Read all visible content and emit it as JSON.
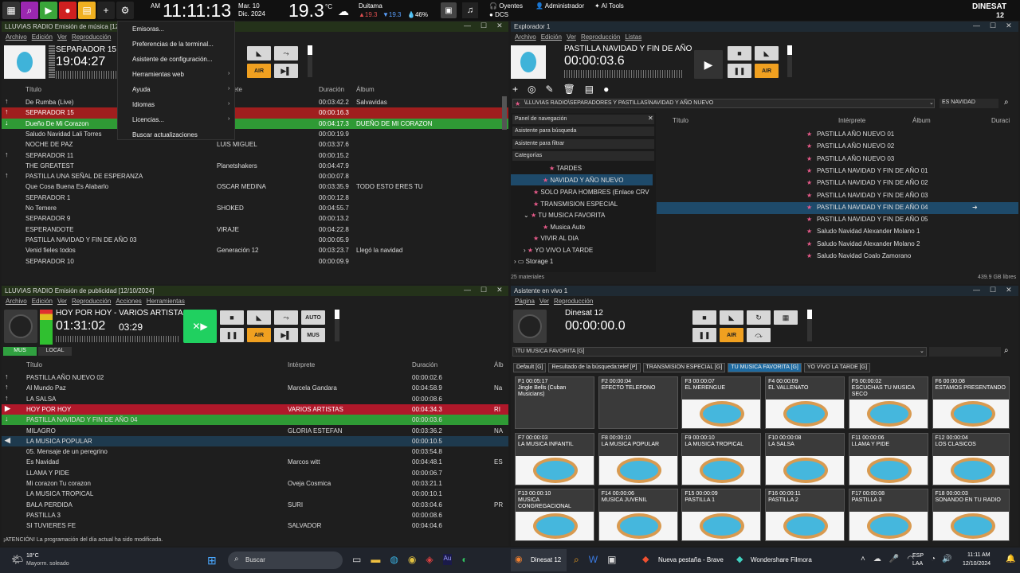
{
  "topbar": {
    "ampm": "AM",
    "time": "11:11:13",
    "date1": "Mar. 10",
    "date2": "Dic. 2024",
    "temp": "19.3",
    "tempunit": "°C",
    "city": "Duitama",
    "t_hi": "19.3",
    "t_lo": "19.3",
    "humidity": "46%",
    "oyentes": "Oyentes",
    "dcs": "DCS",
    "admin": "Administrador",
    "aitools": "AI Tools",
    "brand": "DINESAT",
    "brand_num": "12"
  },
  "music": {
    "title": "LLUVIAS RADIO Emisión de música [12/",
    "menu": [
      "Archivo",
      "Edición",
      "Ver",
      "Reproducción"
    ],
    "now": "SEPARADOR 15",
    "clock": "19:04:27",
    "air": "AIR",
    "headers": {
      "title": "Título",
      "artist": "rprete",
      "duration": "Duración",
      "album": "Álbum"
    },
    "rows": [
      {
        "t": "De Rumba (Live)",
        "a": "o Vivo",
        "d": "00:03:42.2",
        "al": "Salvavidas",
        "ic": "↑"
      },
      {
        "t": "SEPARADOR 15",
        "a": "",
        "d": "00:00:16.3",
        "al": "",
        "ic": "↑"
      },
      {
        "t": "Dueño De Mi Corazon",
        "a": "",
        "d": "00:04:17.3",
        "al": "DUEÑO DE MI CORAZON",
        "ic": "↓"
      },
      {
        "t": "Saludo Navidad Lali Torres",
        "a": "",
        "d": "00:00:19.9",
        "al": "",
        "ic": ""
      },
      {
        "t": "NOCHE DE PAZ",
        "a": "LUIS MIGUEL",
        "d": "00:03:37.6",
        "al": "",
        "ic": ""
      },
      {
        "t": "SEPARADOR 11",
        "a": "",
        "d": "00:00:15.2",
        "al": "",
        "ic": "↑"
      },
      {
        "t": "THE GREATEST",
        "a": "Planetshakers",
        "d": "00:04:47.9",
        "al": "",
        "ic": ""
      },
      {
        "t": "PASTILLA UNA SEÑAL DE ESPERANZA",
        "a": "",
        "d": "00:00:07.8",
        "al": "",
        "ic": "↑"
      },
      {
        "t": "Que Cosa Buena Es Alabarlo",
        "a": "OSCAR MEDINA",
        "d": "00:03:35.9",
        "al": "TODO ESTO ERES TU",
        "ic": ""
      },
      {
        "t": "SEPARADOR 1",
        "a": "",
        "d": "00:00:12.8",
        "al": "",
        "ic": ""
      },
      {
        "t": "No Temere",
        "a": "SHOKED",
        "d": "00:04:55.7",
        "al": "",
        "ic": ""
      },
      {
        "t": "SEPARADOR 9",
        "a": "",
        "d": "00:00:13.2",
        "al": "",
        "ic": ""
      },
      {
        "t": "ESPERANDOTE",
        "a": "VIRAJE",
        "d": "00:04:22.8",
        "al": "",
        "ic": ""
      },
      {
        "t": "PASTILLA NAVIDAD Y FIN DE AÑO 03",
        "a": "",
        "d": "00:00:05.9",
        "al": "",
        "ic": ""
      },
      {
        "t": "Venid fieles todos",
        "a": "Generación 12",
        "d": "00:03:23.7",
        "al": "Llegó la navidad",
        "ic": ""
      },
      {
        "t": "SEPARADOR 10",
        "a": "",
        "d": "00:00:09.9",
        "al": "",
        "ic": ""
      }
    ]
  },
  "dropdown": [
    "Emisoras...",
    "Preferencias de la terminal...",
    "Asistente de configuración...",
    "Herramientas web",
    "Ayuda",
    "Idiomas",
    "Licencias...",
    "Buscar actualizaciones"
  ],
  "explorer": {
    "title": "Explorador 1",
    "menu": [
      "Archivo",
      "Edición",
      "Ver",
      "Reproducción",
      "Listas"
    ],
    "now": "PASTILLA NAVIDAD Y FIN DE AÑO",
    "clock": "00:00:03.6",
    "air": "AIR",
    "path": "\\LLUVIAS RADIO\\SEPARADORES Y PASTILLAS\\NAVIDAD Y AÑO NUEVO",
    "search": "ES NAVIDAD",
    "nav": [
      "Panel de navegación",
      "Asistente para búsqueda",
      "Asistente para filtrar",
      "Categorías"
    ],
    "tree": [
      "TARDES",
      "NAVIDAD Y AÑO NUEVO",
      "SOLO PARA HOMBRES (Enlace CRV",
      "TRANSMISION ESPECIAL",
      "TU MUSICA FAVORITA",
      "Musica Auto",
      "VIVIR AL DIA",
      "YO VIVO LA TARDE",
      "Storage 1"
    ],
    "headers": {
      "title": "Título",
      "artist": "Intérprete",
      "album": "Álbum",
      "dur": "Duraci"
    },
    "rows": [
      "PASTILLA AÑO NUEVO 01",
      "PASTILLA AÑO NUEVO 02",
      "PASTILLA AÑO NUEVO 03",
      "PASTILLA NAVIDAD Y FIN DE AÑO 01",
      "PASTILLA NAVIDAD Y FIN DE AÑO 02",
      "PASTILLA NAVIDAD Y FIN DE AÑO 03",
      "PASTILLA NAVIDAD Y FIN DE AÑO 04",
      "PASTILLA NAVIDAD Y FIN DE AÑO 05",
      "Saludo Navidad Alexander Molano 1",
      "Saludo Navidad Alexander Molano 2",
      "Saludo Navidad Coalo Zamorano"
    ],
    "durs": [
      "00:00:0",
      "00:00:0",
      "00:00:0",
      "00:00:0",
      "00:00:0",
      "00:00:0",
      "00:00:0",
      "00:00:0",
      "00:00:1",
      "00:00:1",
      "00:00:1"
    ],
    "status": "25 materiales",
    "free": "439.9 GB libres"
  },
  "ads": {
    "title": "LLUVIAS RADIO Emisión de publicidad [12/10/2024]",
    "menu": [
      "Archivo",
      "Edición",
      "Ver",
      "Reproducción",
      "Acciones",
      "Herramientas"
    ],
    "now": "HOY POR HOY - VARIOS ARTISTAS",
    "clock": "01:31:02",
    "remain": "03:29",
    "auto": "AUTO",
    "air": "AIR",
    "mus": "MUS",
    "tabs": [
      "MUS",
      "LOCAL"
    ],
    "headers": {
      "title": "Título",
      "artist": "Intérprete",
      "duration": "Duración",
      "album": "Álb"
    },
    "rows": [
      {
        "t": "PASTILLA AÑO NUEVO 02",
        "a": "",
        "d": "00:00:02.6",
        "al": "",
        "ic": "↑"
      },
      {
        "t": "Al Mundo Paz",
        "a": "Marcela Gandara",
        "d": "00:04:58.9",
        "al": "Na",
        "ic": "↑"
      },
      {
        "t": "LA SALSA",
        "a": "",
        "d": "00:00:08.6",
        "al": "",
        "ic": "↑"
      },
      {
        "t": "HOY POR HOY",
        "a": "VARIOS ARTISTAS",
        "d": "00:04:34.3",
        "al": "RI",
        "ic": "▶"
      },
      {
        "t": "PASTILLA NAVIDAD Y FIN DE AÑO 04",
        "a": "",
        "d": "00:00:03.6",
        "al": "",
        "ic": "↓"
      },
      {
        "t": "MILAGRO",
        "a": "GLORIA ESTEFAN",
        "d": "00:03:36.2",
        "al": "NA",
        "ic": ""
      },
      {
        "t": "LA MUSICA POPULAR",
        "a": "",
        "d": "00:00:10.5",
        "al": "",
        "ic": "◀"
      },
      {
        "t": "05. Mensaje de un peregrino",
        "a": "",
        "d": "00:03:54.8",
        "al": "",
        "ic": ""
      },
      {
        "t": "Es Navidad",
        "a": "Marcos witt",
        "d": "00:04:48.1",
        "al": "ES",
        "ic": ""
      },
      {
        "t": "LLAMA Y PIDE",
        "a": "",
        "d": "00:00:06.7",
        "al": "",
        "ic": ""
      },
      {
        "t": "Mi corazon Tu corazon",
        "a": "Oveja Cosmica",
        "d": "00:03:21.1",
        "al": "",
        "ic": ""
      },
      {
        "t": "LA MUSICA TROPICAL",
        "a": "",
        "d": "00:00:10.1",
        "al": "",
        "ic": ""
      },
      {
        "t": "BALA PERDIDA",
        "a": "SURI",
        "d": "00:03:04.6",
        "al": "PR",
        "ic": ""
      },
      {
        "t": "PASTILLA 3",
        "a": "",
        "d": "00:00:08.6",
        "al": "",
        "ic": ""
      },
      {
        "t": "SI TUVIERES FE",
        "a": "SALVADOR",
        "d": "00:04:04.6",
        "al": "",
        "ic": ""
      }
    ],
    "status": "¡ATENCIÓN! La programación del día actual ha sido modificada."
  },
  "live": {
    "title": "Asistente en vivo 1",
    "menu": [
      "Página",
      "Ver",
      "Reproducción"
    ],
    "now": "Dinesat 12",
    "clock": "00:00:00.0",
    "air": "AIR",
    "path": "\\TU MUSICA FAVORITA [G]",
    "tabs": [
      "Default [G]",
      "Resultado de la búsqueda:telef [P]",
      "TRANSMISION ESPECIAL [G]",
      "TU MUSICA FAVORITA [G]",
      "YO VIVO LA TARDE [G]"
    ],
    "cells": [
      {
        "k": "F1  00:05:17",
        "n": "Jingle Bells (Cuban Musicians)",
        "img": false
      },
      {
        "k": "F2  00:00:04",
        "n": "EFECTO TELEFONO",
        "img": false
      },
      {
        "k": "F3  00:00:07",
        "n": "EL MERENGUE",
        "img": true
      },
      {
        "k": "F4  00:00:09",
        "n": "EL VALLENATO",
        "img": true
      },
      {
        "k": "F5  00:00:02",
        "n": "ESCUCHAS TU MUSICA SECO",
        "img": true
      },
      {
        "k": "F6  00:00:08",
        "n": "ESTAMOS PRESENTANDO",
        "img": true
      },
      {
        "k": "F7  00:00:03",
        "n": "LA MUSICA INFANTIL",
        "img": true
      },
      {
        "k": "F8  00:00:10",
        "n": "LA MUSICA POPULAR",
        "img": true
      },
      {
        "k": "F9  00:00:10",
        "n": "LA MUSICA TROPICAL",
        "img": true
      },
      {
        "k": "F10  00:00:08",
        "n": "LA SALSA",
        "img": true
      },
      {
        "k": "F11  00:00:06",
        "n": "LLAMA Y PIDE",
        "img": true
      },
      {
        "k": "F12  00:00:04",
        "n": "LOS CLASICOS",
        "img": true
      },
      {
        "k": "F13  00:00:10",
        "n": "MUSICA CONGREGACIONAL",
        "img": true
      },
      {
        "k": "F14  00:00:06",
        "n": "MUSICA JUVENIL",
        "img": true
      },
      {
        "k": "F15  00:00:09",
        "n": "PASTILLA 1",
        "img": true
      },
      {
        "k": "F16  00:00:11",
        "n": "PASTILLA 2",
        "img": true
      },
      {
        "k": "F17  00:00:08",
        "n": "PASTILLA 3",
        "img": true
      },
      {
        "k": "F18  00:00:03",
        "n": "SONANDO EN TU RADIO",
        "img": true
      }
    ]
  },
  "taskbar": {
    "temp": "18°C",
    "weather": "Mayorm. soleado",
    "search": "Buscar",
    "app1": "Dinesat 12",
    "app2": "Nueva pestaña - Brave",
    "app3": "Wondershare Filmora",
    "lang1": "ESP",
    "lang2": "LAA",
    "time": "11:11 AM",
    "date": "12/10/2024",
    "au": "Au"
  }
}
